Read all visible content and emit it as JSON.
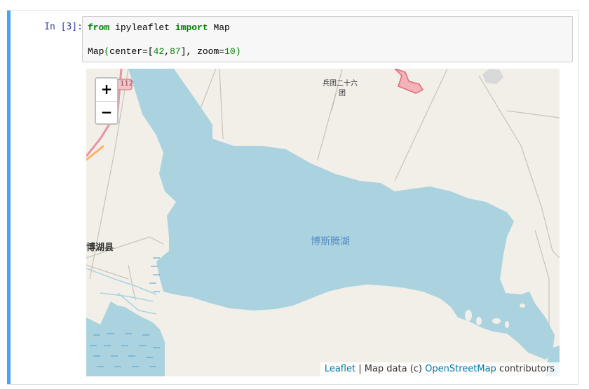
{
  "cell": {
    "prompt": "In [3]:",
    "code": {
      "line1": {
        "kw_from": "from",
        "module": " ipyleaflet ",
        "kw_import": "import",
        "name": " Map"
      },
      "line2": {
        "func": "Map",
        "open": "(",
        "args_a": "center=[",
        "lat": "42",
        "comma": ",",
        "lon": "87",
        "args_b": "], zoom=",
        "zoom": "10",
        "close": ")"
      }
    }
  },
  "map": {
    "zoom_in": "+",
    "zoom_out": "−",
    "labels": {
      "lake": "博斯腾湖",
      "county": "博湖县",
      "village": "兵团二十六",
      "village_suffix": "团",
      "road": "112"
    },
    "attribution": {
      "leaflet": "Leaflet",
      "sep": " | Map data (c) ",
      "osm": "OpenStreetMap",
      "suffix": " contributors"
    },
    "colors": {
      "water": "#aad3df",
      "land": "#f2efe9",
      "road_pink": "#e892a2",
      "road_orange": "#f9b26a"
    }
  }
}
